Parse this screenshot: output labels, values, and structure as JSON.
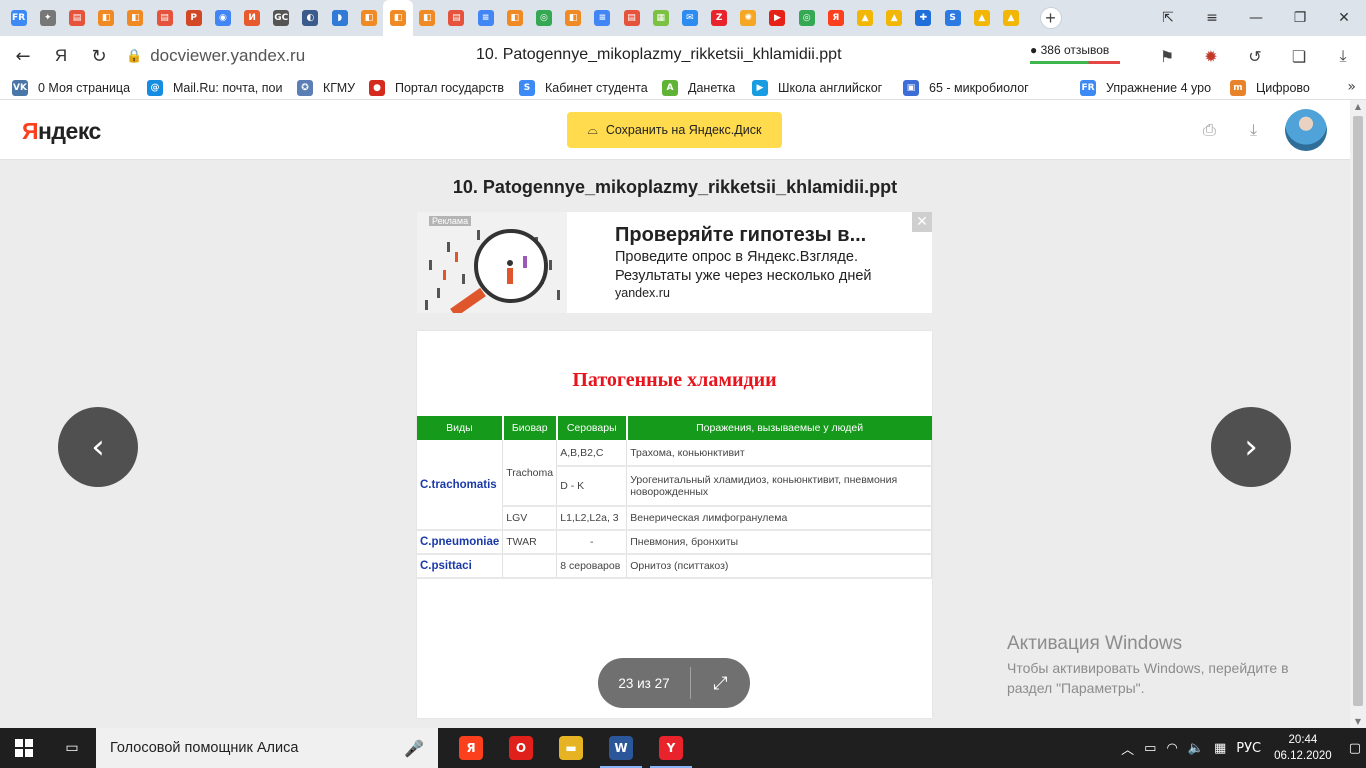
{
  "browser": {
    "tab_favicons": [
      {
        "name": "fr",
        "color": "#3d8af7",
        "glyph": "FR"
      },
      {
        "name": "puzzle",
        "color": "#777777",
        "glyph": "✦"
      },
      {
        "name": "pdf",
        "color": "#e6533c",
        "glyph": "▤"
      },
      {
        "name": "doc-orange",
        "color": "#f08a24",
        "glyph": "◧"
      },
      {
        "name": "doc-orange",
        "color": "#f08a24",
        "glyph": "◧"
      },
      {
        "name": "pdf",
        "color": "#e6533c",
        "glyph": "▤"
      },
      {
        "name": "ppt",
        "color": "#d24726",
        "glyph": "P"
      },
      {
        "name": "img",
        "color": "#4285f4",
        "glyph": "◉"
      },
      {
        "name": "i",
        "color": "#e65a2e",
        "glyph": "И"
      },
      {
        "name": "gc",
        "color": "#555555",
        "glyph": "GC"
      },
      {
        "name": "shell",
        "color": "#3b5b8c",
        "glyph": "◐"
      },
      {
        "name": "edge",
        "color": "#2f7bd6",
        "glyph": "◗"
      },
      {
        "name": "doc-orange",
        "color": "#f08a24",
        "glyph": "◧"
      },
      {
        "name": "doc-orange",
        "color": "#f08a24",
        "glyph": "◧"
      },
      {
        "name": "doc-orange",
        "color": "#f08a24",
        "glyph": "◧"
      },
      {
        "name": "pdf",
        "color": "#e6533c",
        "glyph": "▤"
      },
      {
        "name": "gdoc",
        "color": "#4285f4",
        "glyph": "≡"
      },
      {
        "name": "doc-orange",
        "color": "#f08a24",
        "glyph": "◧"
      },
      {
        "name": "chrome",
        "color": "#34a853",
        "glyph": "◎"
      },
      {
        "name": "doc-orange",
        "color": "#f08a24",
        "glyph": "◧"
      },
      {
        "name": "gdoc",
        "color": "#4285f4",
        "glyph": "≡"
      },
      {
        "name": "pdf",
        "color": "#e6533c",
        "glyph": "▤"
      },
      {
        "name": "game",
        "color": "#7cc142",
        "glyph": "▦"
      },
      {
        "name": "chat",
        "color": "#2d8cf0",
        "glyph": "✉"
      },
      {
        "name": "z",
        "color": "#e8232b",
        "glyph": "Z"
      },
      {
        "name": "sun",
        "color": "#f5a623",
        "glyph": "✺"
      },
      {
        "name": "youtube",
        "color": "#e62117",
        "glyph": "▶"
      },
      {
        "name": "chrome",
        "color": "#34a853",
        "glyph": "◎"
      },
      {
        "name": "yandex",
        "color": "#fc3f1d",
        "glyph": "Я"
      },
      {
        "name": "img-yellow",
        "color": "#f2b705",
        "glyph": "▲"
      },
      {
        "name": "img-yellow",
        "color": "#f2b705",
        "glyph": "▲"
      },
      {
        "name": "plus",
        "color": "#1e6fd9",
        "glyph": "✚"
      },
      {
        "name": "s",
        "color": "#2a7ae2",
        "glyph": "S"
      },
      {
        "name": "img-yellow",
        "color": "#f2b705",
        "glyph": "▲"
      },
      {
        "name": "img-yellow",
        "color": "#f2b705",
        "glyph": "▲"
      }
    ],
    "active_tab_index": 13,
    "new_tab": "+",
    "domain": "docviewer.yandex.ru",
    "page_title": "10. Patogennye_mikoplazmy_rikketsii_khlamidii.ppt",
    "reviews": "386 отзывов",
    "bookmarks": [
      {
        "label": "0 Моя страница",
        "color": "#4a76a8",
        "glyph": "VK",
        "width": 135
      },
      {
        "label": "Mail.Ru: почта, пои",
        "color": "#168de2",
        "glyph": "@",
        "width": 150
      },
      {
        "label": "КГМУ",
        "color": "#5b7fb5",
        "glyph": "✪",
        "width": 72
      },
      {
        "label": "Портал государств",
        "color": "#d52b1e",
        "glyph": "●",
        "width": 150
      },
      {
        "label": "Кабинет студента",
        "color": "#3d8af7",
        "glyph": "S",
        "width": 143
      },
      {
        "label": "Данетка",
        "color": "#5fb336",
        "glyph": "A",
        "width": 90
      },
      {
        "label": "Школа английског",
        "color": "#1a9de0",
        "glyph": "▶",
        "width": 151
      },
      {
        "label": "65 - микробиолог",
        "color": "#3d6dd6",
        "glyph": "▣",
        "width": 177
      },
      {
        "label": "Упражнение 4 уро",
        "color": "#3d8af7",
        "glyph": "FR",
        "width": 150
      },
      {
        "label": "Цифрово",
        "color": "#e8832a",
        "glyph": "m",
        "width": 110
      }
    ]
  },
  "viewer": {
    "logo_first": "Я",
    "logo_rest": "ндекс",
    "save_label": "Сохранить на Яндекс.Диск",
    "doc_title": "10. Patogennye_mikoplazmy_rikketsii_khlamidii.ppt",
    "pager": "23 из 27"
  },
  "ad": {
    "label": "Реклама",
    "title": "Проверяйте гипотезы в...",
    "text": "Проведите опрос в Яндекс.Взгляде. Результаты уже через несколько дней",
    "url": "yandex.ru"
  },
  "slide": {
    "title": "Патогенные хламидии",
    "headers": [
      "Виды",
      "Биовар",
      "Серовары",
      "Поражения, вызываемые у людей"
    ],
    "rows": [
      {
        "species": "C.trachomatis",
        "biovar": "Trachoma",
        "serovar": "A,B,B2,C",
        "disease": "Трахома, коньюнктивит"
      },
      {
        "species": "",
        "biovar": "",
        "serovar": "D - K",
        "disease": "Урогенитальный хламидиоз, коньюнктивит, пневмония новорожденных"
      },
      {
        "species": "",
        "biovar": "LGV",
        "serovar": "L1,L2,L2a,  3",
        "disease": "Венерическая лимфогранулема"
      },
      {
        "species": "C.pneumoniae",
        "biovar": "TWAR",
        "serovar": "-",
        "disease": "Пневмония, бронхиты"
      },
      {
        "species": "C.psittaci",
        "biovar": "",
        "serovar": "8 сероваров",
        "disease": "Орнитоз (пситтакоз)"
      }
    ]
  },
  "watermark": {
    "line1": "Активация Windows",
    "line2": "Чтобы активировать Windows, перейдите в раздел \"Параметры\"."
  },
  "taskbar": {
    "search": "Голосовой помощник Алиса",
    "apps": [
      {
        "name": "yandex-browser",
        "color": "#fc3f1d",
        "glyph": "Я",
        "open": false
      },
      {
        "name": "opera",
        "color": "#e0201b",
        "glyph": "O",
        "open": false
      },
      {
        "name": "explorer",
        "color": "#e6b422",
        "glyph": "▬",
        "open": false
      },
      {
        "name": "word",
        "color": "#2b579a",
        "glyph": "W",
        "open": true
      },
      {
        "name": "yandex",
        "color": "#e8232b",
        "glyph": "Y",
        "open": true
      }
    ],
    "lang": "РУС",
    "time": "20:44",
    "date": "06.12.2020"
  }
}
